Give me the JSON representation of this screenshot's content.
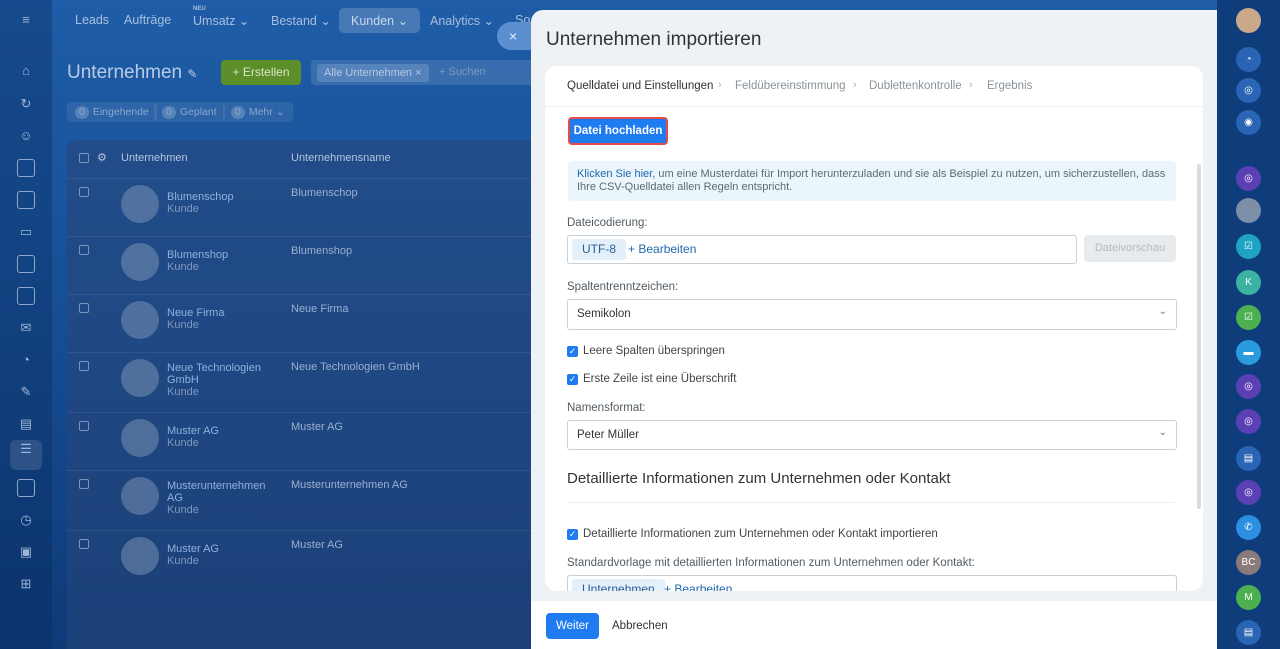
{
  "background": {
    "nav": [
      "Leads",
      "Aufträge",
      "Umsatz",
      "Bestand",
      "Kunden",
      "Analytics",
      "So"
    ],
    "nav_badge": "NEU",
    "title": "Unternehmen",
    "create_label": "+ Erstellen",
    "filter_chip": "Alle Unternehmen",
    "search_placeholder": "+ Suchen",
    "counters": [
      {
        "count": "0",
        "label": "Eingehende"
      },
      {
        "count": "0",
        "label": "Geplant"
      },
      {
        "count": "0",
        "label": "Mehr"
      }
    ],
    "table_headers": [
      "Unternehmen",
      "Unternehmensname"
    ],
    "rows": [
      {
        "name": "Blumenschop",
        "kind": "Kunde",
        "company": "Blumenschop"
      },
      {
        "name": "Blumenshop",
        "kind": "Kunde",
        "company": "Blumenshop"
      },
      {
        "name": "Neue Firma",
        "kind": "Kunde",
        "company": "Neue Firma"
      },
      {
        "name": "Neue Technologien GmbH",
        "kind": "Kunde",
        "company": "Neue Technologien GmbH"
      },
      {
        "name": "Muster AG",
        "kind": "Kunde",
        "company": "Muster AG"
      },
      {
        "name": "Musterunternehmen AG",
        "kind": "Kunde",
        "company": "Musterunternehmen AG"
      },
      {
        "name": "Muster AG",
        "kind": "Kunde",
        "company": "Muster AG"
      }
    ]
  },
  "right_rail": {
    "initials": [
      "K",
      "BC",
      "M"
    ]
  },
  "panel": {
    "title": "Unternehmen importieren",
    "steps": [
      "Quelldatei und Einstellungen",
      "Feldübereinstimmung",
      "Dublettenkontrolle",
      "Ergebnis"
    ],
    "upload_button": "Datei hochladen",
    "info_link": "Klicken Sie hier",
    "info_text": ", um eine Musterdatei für Import herunterzuladen und sie als Beispiel zu nutzen, um sicherzustellen, dass Ihre CSV-Quelldatei allen Regeln entspricht.",
    "encoding_label": "Dateicodierung:",
    "encoding_value": "UTF-8",
    "edit_label": "+ Bearbeiten",
    "preview_button": "Dateivorschau",
    "separator_label": "Spaltentrenntzeichen:",
    "separator_value": "Semikolon",
    "skip_empty_label": "Leere Spalten überspringen",
    "first_row_header_label": "Erste Zeile ist eine Überschrift",
    "name_format_label": "Namensformat:",
    "name_format_value": "Peter Müller",
    "section_title": "Detaillierte Informationen zum Unternehmen oder Kontakt",
    "import_details_label": "Detaillierte Informationen zum Unternehmen oder Kontakt importieren",
    "template_label": "Standardvorlage mit detaillierten Informationen zum Unternehmen oder Kontakt:",
    "template_value": "Unternehmen",
    "next_button": "Weiter",
    "cancel_button": "Abbrechen",
    "close_icon": "×"
  }
}
